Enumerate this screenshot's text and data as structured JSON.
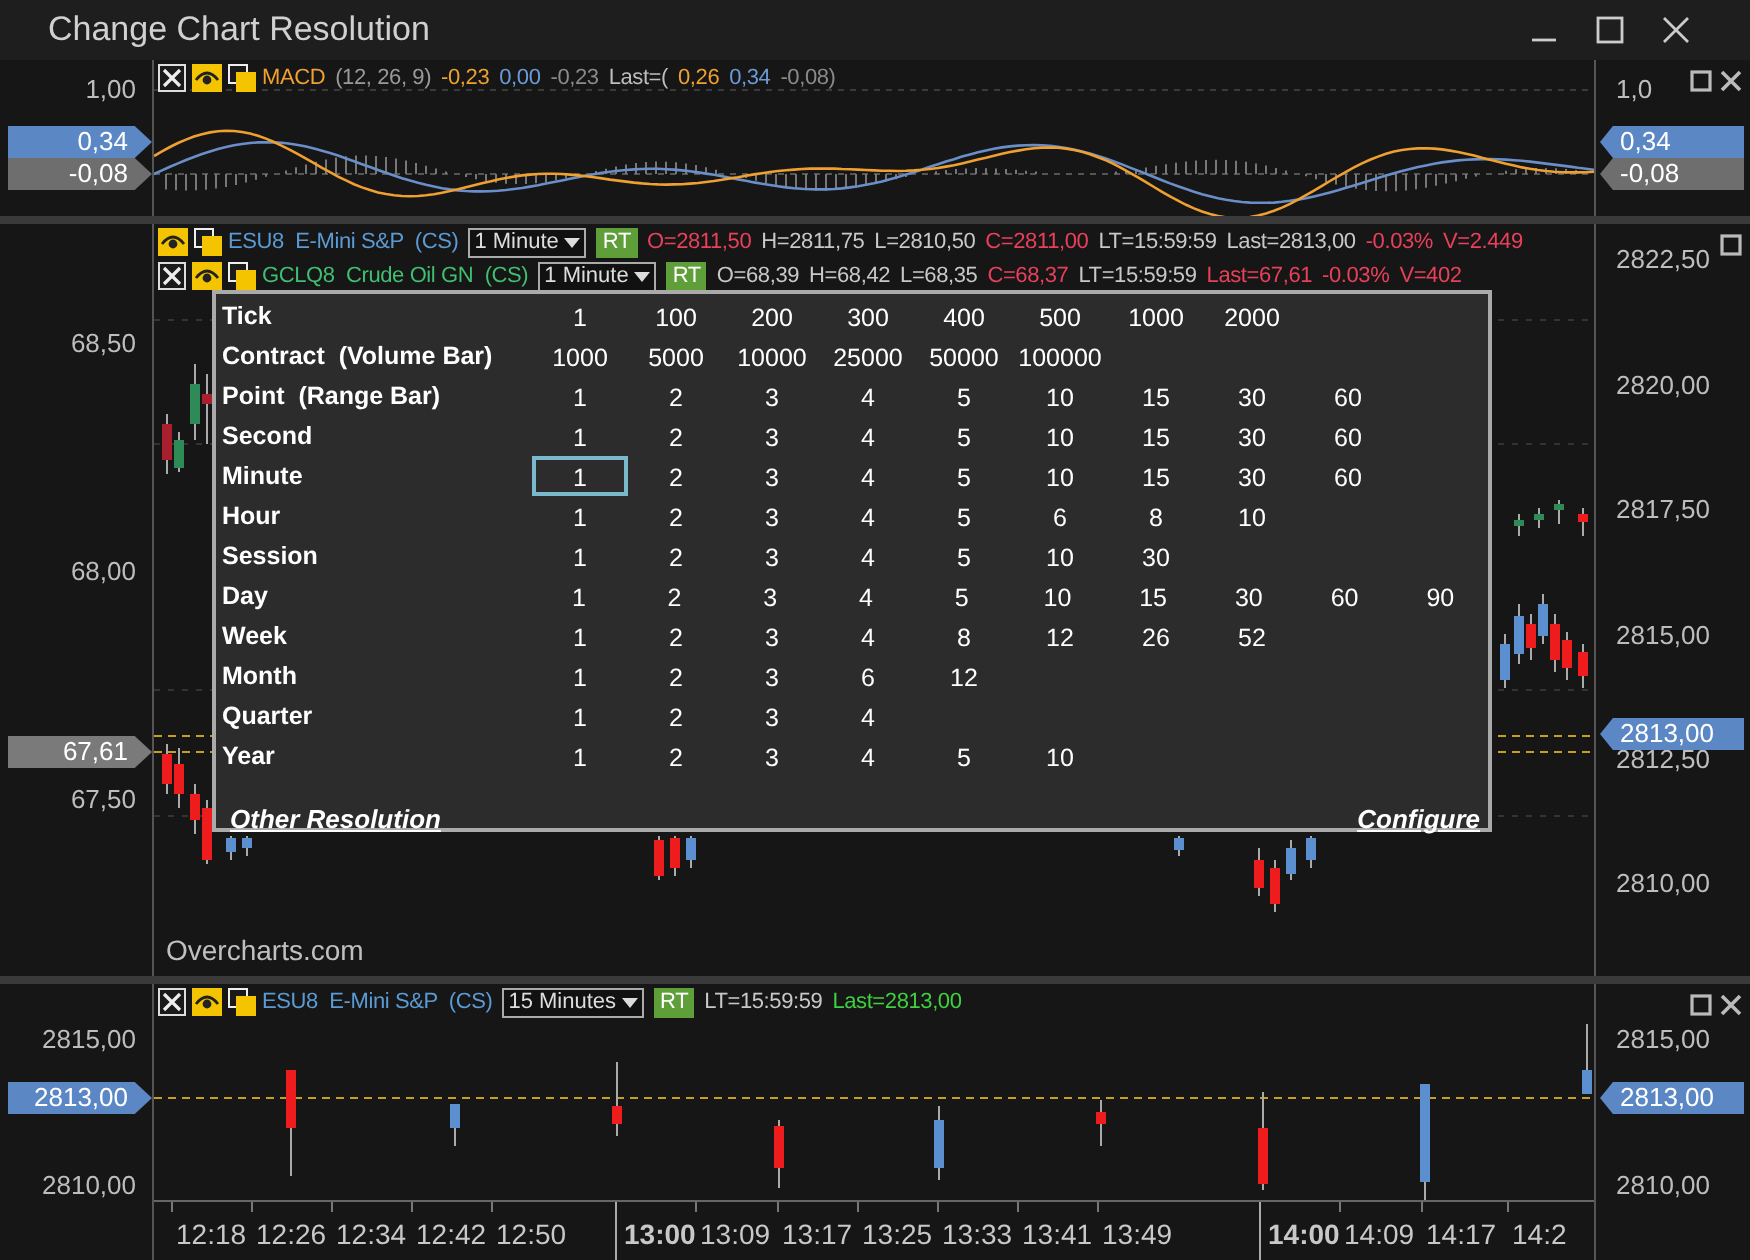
{
  "window": {
    "title": "Change Chart Resolution"
  },
  "macd_pane": {
    "legend": {
      "closable": true,
      "segments": [
        {
          "text": "MACD",
          "color": "#f0a030"
        },
        {
          "text": "(12, 26, 9)",
          "color": "#9a9a9a"
        },
        {
          "text": "-0,23",
          "color": "#f0a030"
        },
        {
          "text": "0,00",
          "color": "#6a9ad8"
        },
        {
          "text": "-0,23",
          "color": "#8a8a8a"
        },
        {
          "text": "Last=(",
          "color": "#bdbdbd"
        },
        {
          "text": "0,26",
          "color": "#f0a030"
        },
        {
          "text": "0,34",
          "color": "#6a9ad8"
        },
        {
          "text": "-0,08)",
          "color": "#8a8a8a"
        }
      ]
    },
    "left_axis": {
      "ticks": [
        "1,00"
      ],
      "markers": [
        {
          "text": "0,34",
          "color": "#5b87c5"
        },
        {
          "text": "-0,08",
          "color": "#6e6e6e"
        }
      ]
    },
    "right_axis": {
      "ticks": [
        "1,0"
      ],
      "markers": [
        {
          "text": "0,34",
          "color": "#5b87c5"
        },
        {
          "text": "-0,08",
          "color": "#6e6e6e"
        }
      ]
    }
  },
  "main_pane": {
    "series": [
      {
        "closable": false,
        "symbol": "ESU8  E-Mini S&P  (CS)",
        "color": "#5b9bd5",
        "resolution": "1 Minute",
        "badge": "RT",
        "values": [
          {
            "text": "O=2811,50",
            "color": "#e8405a"
          },
          {
            "text": "H=2811,75",
            "color": "#c8c8c8"
          },
          {
            "text": "L=2810,50",
            "color": "#c8c8c8"
          },
          {
            "text": "C=2811,00",
            "color": "#e8405a"
          },
          {
            "text": "LT=15:59:59",
            "color": "#c8c8c8"
          },
          {
            "text": "Last=2813,00",
            "color": "#c8c8c8"
          },
          {
            "text": "-0.03%",
            "color": "#e8405a"
          },
          {
            "text": "V=2.449",
            "color": "#e8405a"
          }
        ]
      },
      {
        "closable": true,
        "symbol": "GCLQ8  Crude Oil GN  (CS)",
        "color": "#3fbf6f",
        "resolution": "1 Minute",
        "badge": "RT",
        "values": [
          {
            "text": "O=68,39",
            "color": "#c8c8c8"
          },
          {
            "text": "H=68,42",
            "color": "#c8c8c8"
          },
          {
            "text": "L=68,35",
            "color": "#c8c8c8"
          },
          {
            "text": "C=68,37",
            "color": "#e8405a"
          },
          {
            "text": "LT=15:59:59",
            "color": "#c8c8c8"
          },
          {
            "text": "Last=67,61",
            "color": "#e8405a"
          },
          {
            "text": "-0.03%",
            "color": "#e8405a"
          },
          {
            "text": "V=402",
            "color": "#e8405a"
          }
        ]
      }
    ],
    "left_axis": {
      "ticks": [
        "68,50",
        "68,00",
        "67,50"
      ],
      "markers": [
        {
          "text": "67,61",
          "color": "#7a7a7a"
        }
      ]
    },
    "right_axis": {
      "ticks": [
        "2822,50",
        "2820,00",
        "2817,50",
        "2815,00",
        "2812,50",
        "2810,00"
      ],
      "markers": [
        {
          "text": "2813,00",
          "color": "#5b87c5"
        }
      ]
    },
    "brand_text": "Overcharts.com",
    "popup": {
      "rows": [
        {
          "label": "Tick",
          "values": [
            {
              "text": "1",
              "selected": false
            },
            {
              "text": "100",
              "selected": false
            },
            {
              "text": "200",
              "selected": false
            },
            {
              "text": "300",
              "selected": false
            },
            {
              "text": "400",
              "selected": false
            },
            {
              "text": "500",
              "selected": false
            },
            {
              "text": "1000",
              "selected": false
            },
            {
              "text": "2000",
              "selected": false
            }
          ]
        },
        {
          "label": "Contract  (Volume Bar)",
          "values": [
            {
              "text": "1000",
              "selected": false
            },
            {
              "text": "5000",
              "selected": false
            },
            {
              "text": "10000",
              "selected": false
            },
            {
              "text": "25000",
              "selected": false
            },
            {
              "text": "50000",
              "selected": false
            },
            {
              "text": "100000",
              "selected": false
            }
          ]
        },
        {
          "label": "Point  (Range Bar)",
          "values": [
            {
              "text": "1",
              "selected": false
            },
            {
              "text": "2",
              "selected": false
            },
            {
              "text": "3",
              "selected": false
            },
            {
              "text": "4",
              "selected": false
            },
            {
              "text": "5",
              "selected": false
            },
            {
              "text": "10",
              "selected": false
            },
            {
              "text": "15",
              "selected": false
            },
            {
              "text": "30",
              "selected": false
            },
            {
              "text": "60",
              "selected": false
            }
          ]
        },
        {
          "label": "Second",
          "values": [
            {
              "text": "1",
              "selected": false
            },
            {
              "text": "2",
              "selected": false
            },
            {
              "text": "3",
              "selected": false
            },
            {
              "text": "4",
              "selected": false
            },
            {
              "text": "5",
              "selected": false
            },
            {
              "text": "10",
              "selected": false
            },
            {
              "text": "15",
              "selected": false
            },
            {
              "text": "30",
              "selected": false
            },
            {
              "text": "60",
              "selected": false
            }
          ]
        },
        {
          "label": "Minute",
          "values": [
            {
              "text": "1",
              "selected": true
            },
            {
              "text": "2",
              "selected": false
            },
            {
              "text": "3",
              "selected": false
            },
            {
              "text": "4",
              "selected": false
            },
            {
              "text": "5",
              "selected": false
            },
            {
              "text": "10",
              "selected": false
            },
            {
              "text": "15",
              "selected": false
            },
            {
              "text": "30",
              "selected": false
            },
            {
              "text": "60",
              "selected": false
            }
          ]
        },
        {
          "label": "Hour",
          "values": [
            {
              "text": "1",
              "selected": false
            },
            {
              "text": "2",
              "selected": false
            },
            {
              "text": "3",
              "selected": false
            },
            {
              "text": "4",
              "selected": false
            },
            {
              "text": "5",
              "selected": false
            },
            {
              "text": "6",
              "selected": false
            },
            {
              "text": "8",
              "selected": false
            },
            {
              "text": "10",
              "selected": false
            }
          ]
        },
        {
          "label": "Session",
          "values": [
            {
              "text": "1",
              "selected": false
            },
            {
              "text": "2",
              "selected": false
            },
            {
              "text": "3",
              "selected": false
            },
            {
              "text": "4",
              "selected": false
            },
            {
              "text": "5",
              "selected": false
            },
            {
              "text": "10",
              "selected": false
            },
            {
              "text": "30",
              "selected": false
            }
          ]
        },
        {
          "label": "Day",
          "values": [
            {
              "text": "1",
              "selected": false
            },
            {
              "text": "2",
              "selected": false
            },
            {
              "text": "3",
              "selected": false
            },
            {
              "text": "4",
              "selected": false
            },
            {
              "text": "5",
              "selected": false
            },
            {
              "text": "10",
              "selected": false
            },
            {
              "text": "15",
              "selected": false
            },
            {
              "text": "30",
              "selected": false
            },
            {
              "text": "60",
              "selected": false
            },
            {
              "text": "90",
              "selected": false
            }
          ]
        },
        {
          "label": "Week",
          "values": [
            {
              "text": "1",
              "selected": false
            },
            {
              "text": "2",
              "selected": false
            },
            {
              "text": "3",
              "selected": false
            },
            {
              "text": "4",
              "selected": false
            },
            {
              "text": "8",
              "selected": false
            },
            {
              "text": "12",
              "selected": false
            },
            {
              "text": "26",
              "selected": false
            },
            {
              "text": "52",
              "selected": false
            }
          ]
        },
        {
          "label": "Month",
          "values": [
            {
              "text": "1",
              "selected": false
            },
            {
              "text": "2",
              "selected": false
            },
            {
              "text": "3",
              "selected": false
            },
            {
              "text": "6",
              "selected": false
            },
            {
              "text": "12",
              "selected": false
            }
          ]
        },
        {
          "label": "Quarter",
          "values": [
            {
              "text": "1",
              "selected": false
            },
            {
              "text": "2",
              "selected": false
            },
            {
              "text": "3",
              "selected": false
            },
            {
              "text": "4",
              "selected": false
            }
          ]
        },
        {
          "label": "Year",
          "values": [
            {
              "text": "1",
              "selected": false
            },
            {
              "text": "2",
              "selected": false
            },
            {
              "text": "3",
              "selected": false
            },
            {
              "text": "4",
              "selected": false
            },
            {
              "text": "5",
              "selected": false
            },
            {
              "text": "10",
              "selected": false
            }
          ]
        }
      ],
      "links": [
        "Other Resolution",
        "Configure"
      ]
    }
  },
  "bottom_pane": {
    "series": [
      {
        "closable": true,
        "symbol": "ESU8  E-Mini S&P  (CS)",
        "color": "#5b9bd5",
        "resolution": "15 Minutes",
        "badge": "RT",
        "values": [
          {
            "text": "LT=15:59:59",
            "color": "#c8c8c8"
          },
          {
            "text": "Last=2813,00",
            "color": "#3fcf3f"
          }
        ]
      }
    ],
    "left_axis": {
      "ticks": [
        "2815,00",
        "2810,00"
      ],
      "markers": [
        {
          "text": "2813,00",
          "color": "#5b87c5"
        }
      ]
    },
    "right_axis": {
      "ticks": [
        "2815,00",
        "2810,00"
      ],
      "markers": [
        {
          "text": "2813,00",
          "color": "#5b87c5"
        }
      ]
    }
  },
  "time_axis": [
    {
      "text": "12:18",
      "bold": false
    },
    {
      "text": "12:26",
      "bold": false
    },
    {
      "text": "12:34",
      "bold": false
    },
    {
      "text": "12:42",
      "bold": false
    },
    {
      "text": "12:50",
      "bold": false
    },
    {
      "text": "13:00",
      "bold": true
    },
    {
      "text": "13:09",
      "bold": false
    },
    {
      "text": "13:17",
      "bold": false
    },
    {
      "text": "13:25",
      "bold": false
    },
    {
      "text": "13:33",
      "bold": false
    },
    {
      "text": "13:41",
      "bold": false
    },
    {
      "text": "13:49",
      "bold": false
    },
    {
      "text": "14:00",
      "bold": true
    },
    {
      "text": "14:09",
      "bold": false
    },
    {
      "text": "14:17",
      "bold": false
    },
    {
      "text": "14:2",
      "bold": false
    }
  ]
}
